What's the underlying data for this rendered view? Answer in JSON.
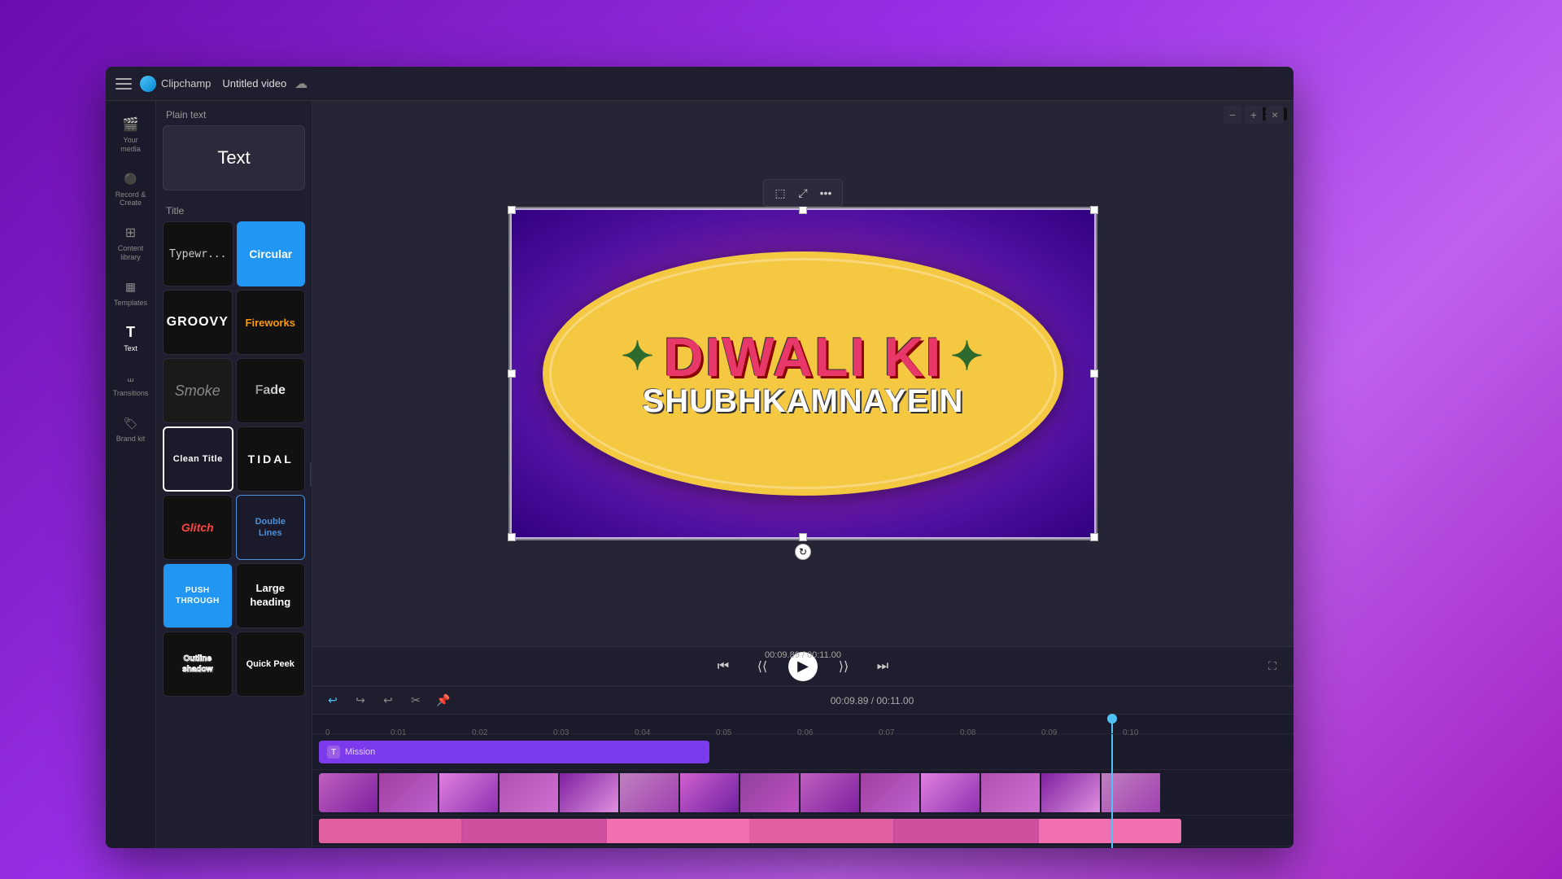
{
  "titleBar": {
    "menuLabel": "Menu",
    "brandName": "Clipchamp",
    "videoTitle": "Untitled video",
    "saveIcon": "cloud-save-icon"
  },
  "sidebar": {
    "items": [
      {
        "id": "your-media",
        "label": "Your media",
        "icon": "media-icon"
      },
      {
        "id": "record-create",
        "label": "Record & Create",
        "icon": "record-icon"
      },
      {
        "id": "content-library",
        "label": "Content library",
        "icon": "library-icon"
      },
      {
        "id": "templates",
        "label": "Templates",
        "icon": "templates-icon"
      },
      {
        "id": "text",
        "label": "Text",
        "icon": "text-icon",
        "active": true
      },
      {
        "id": "transitions",
        "label": "Transitions",
        "icon": "transitions-icon"
      },
      {
        "id": "brand-kit",
        "label": "Brand kit",
        "icon": "brand-kit-icon"
      }
    ]
  },
  "textPanel": {
    "plainText": {
      "sectionLabel": "Plain text",
      "styles": [
        {
          "id": "text",
          "label": "Text",
          "type": "plain"
        }
      ]
    },
    "title": {
      "sectionLabel": "Title",
      "styles": [
        {
          "id": "typewriter",
          "label": "Typewr...",
          "type": "typewriter"
        },
        {
          "id": "circular",
          "label": "Circular",
          "type": "circular"
        },
        {
          "id": "groovy",
          "label": "GROOVY",
          "type": "groovy"
        },
        {
          "id": "fireworks",
          "label": "Fireworks",
          "type": "fireworks"
        },
        {
          "id": "smoke",
          "label": "Smoke",
          "type": "smoke"
        },
        {
          "id": "fade",
          "label": "Fade",
          "type": "fade"
        },
        {
          "id": "clean-title",
          "label": "Clean Title",
          "type": "clean-title"
        },
        {
          "id": "tidal",
          "label": "TIDAL",
          "type": "tidal"
        },
        {
          "id": "glitch",
          "label": "Glitch",
          "type": "glitch"
        },
        {
          "id": "double-lines",
          "label": "Double Lines",
          "type": "double-lines"
        },
        {
          "id": "push-through",
          "label": "PUSH THROUGH",
          "type": "push-through"
        },
        {
          "id": "large-heading",
          "label": "Large heading",
          "type": "large-heading"
        },
        {
          "id": "outline-shadow",
          "label": "Outline shadow",
          "type": "outline-shadow"
        },
        {
          "id": "quick-peek",
          "label": "Quick Peek",
          "type": "quick-peek"
        }
      ]
    }
  },
  "canvas": {
    "aspectRatio": "16:9",
    "diwali": {
      "line1": "DIWALI KI",
      "line2": "SHUBHKAMNAYEIN"
    }
  },
  "playback": {
    "timeDisplay": "00:09.89 / 00:11.00",
    "prevFrameLabel": "Previous frame",
    "rewindLabel": "Rewind",
    "playLabel": "Play",
    "forwardLabel": "Forward",
    "nextFrameLabel": "Next frame"
  },
  "timeline": {
    "toolbar": {
      "undoLabel": "Undo",
      "redoLabel": "Redo",
      "undoAltLabel": "Undo (alt)",
      "cutLabel": "Cut",
      "snappingLabel": "Snapping"
    },
    "tracks": [
      {
        "id": "text-track",
        "type": "text",
        "clipLabel": "Mission"
      },
      {
        "id": "video-track",
        "type": "video"
      },
      {
        "id": "audio-track",
        "type": "audio"
      }
    ],
    "rulerMarks": [
      "0",
      "0:01",
      "0:02",
      "0:03",
      "0:04",
      "0:05",
      "0:06",
      "0:07",
      "0:08",
      "0:09",
      "0:10"
    ],
    "playheadPosition": "980px"
  },
  "icons": {
    "menu": "☰",
    "media": "🎬",
    "record": "⚪",
    "library": "📚",
    "templates": "▦",
    "text": "T",
    "transitions": "↔",
    "brandKit": "🏷",
    "undo": "↩",
    "redo": "↪",
    "undoAlt": "↩",
    "cut": "✂",
    "snapping": "📌",
    "skipBack": "⏮",
    "rewind": "⏪",
    "play": "▶",
    "fastForward": "⏩",
    "skipForward": "⏭",
    "fullscreen": "⛶",
    "zoomIn": "+",
    "zoomOut": "−",
    "collapseLeft": "‹",
    "resize": "⤢",
    "crop": "⬚",
    "moreOptions": "•••"
  }
}
